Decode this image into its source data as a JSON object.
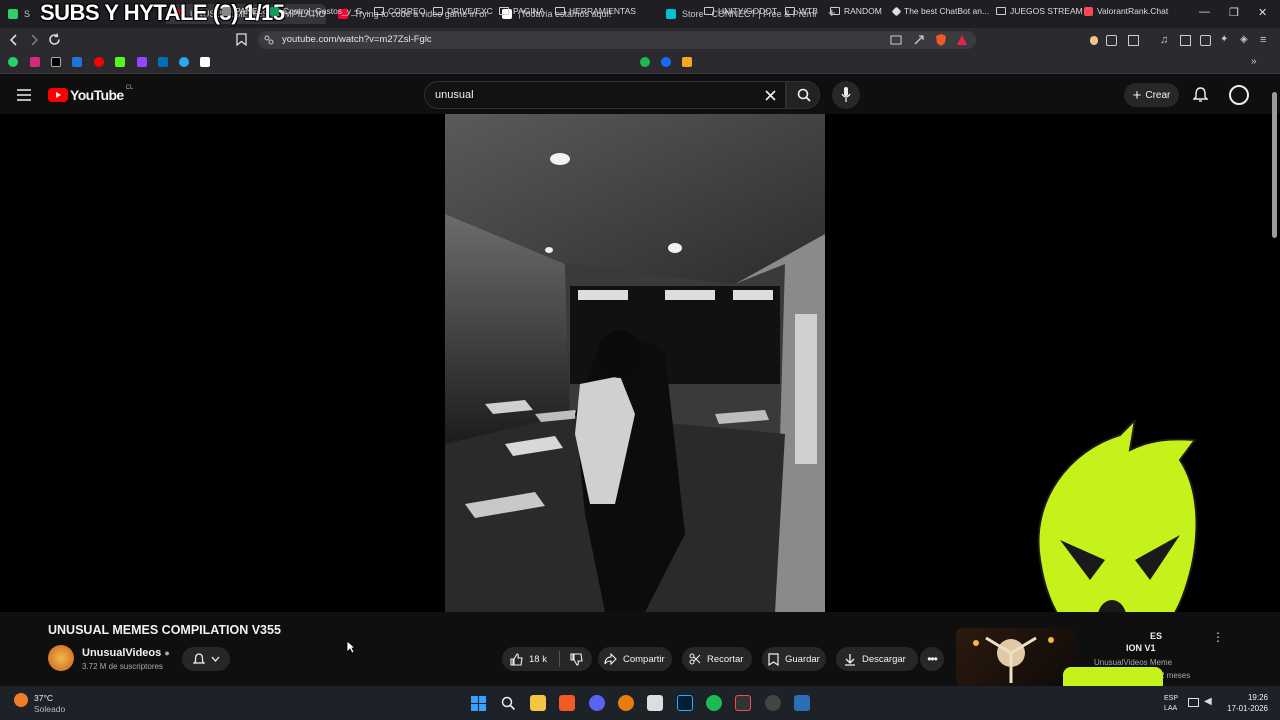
{
  "overlay": {
    "title": "SUBS Y HYTALE (3) 1/15"
  },
  "tabs": [
    {
      "label": "S",
      "color": "#33cc66"
    },
    {
      "label": "UNUSUAL MEMES COMPILATION",
      "color": "#ff0000"
    },
    {
      "label": "Trying to code a video game in one",
      "color": "#ff0033"
    },
    {
      "label": "¡Todavía estamos aquí!",
      "color": "#ffffff"
    },
    {
      "label": "Store - CONNECT | Free & Premium",
      "color": "#00c2d4"
    }
  ],
  "browser": {
    "url": "youtube.com/watch?v=m27Zsl-Fglc",
    "win_minimize": "—",
    "win_restore": "❐",
    "win_close": "✕"
  },
  "bookmarks": [
    "PANEL",
    "Control_Gastos_y_G...",
    "CORREO",
    "DRIVE/EXC",
    "PAGINA",
    "HERRAMIENTAS",
    "UNITY/GODOT",
    "WTB",
    "RANDOM",
    "The best ChatBot an...",
    "JUEGOS STREAM",
    "ValorantRank.Chat"
  ],
  "youtube": {
    "logo": "YouTube",
    "region": "CL",
    "search_value": "unusual",
    "create_label": "Crear"
  },
  "video": {
    "title": "UNUSUAL MEMES COMPILATION V355",
    "channel": "UnusualVideos",
    "subscribers": "3.72 M de suscriptores",
    "likes": "18 k",
    "share": "Compartir",
    "clip": "Recortar",
    "save": "Guardar",
    "download": "Descargar"
  },
  "recommended": {
    "title_fragment_1": "ES",
    "title_fragment_2": "ION V1",
    "channel": "UnusualVideos Meme",
    "age": "2 meses"
  },
  "taskbar": {
    "temp": "37°C",
    "weather": "Soleado",
    "lang": "ESP",
    "lang2": "LAA",
    "time": "19:26",
    "date": "17-01-2026"
  },
  "colors": {
    "yt_red": "#ff0000",
    "mascot": "#c6f21c",
    "bg": "#0f0f0f"
  }
}
